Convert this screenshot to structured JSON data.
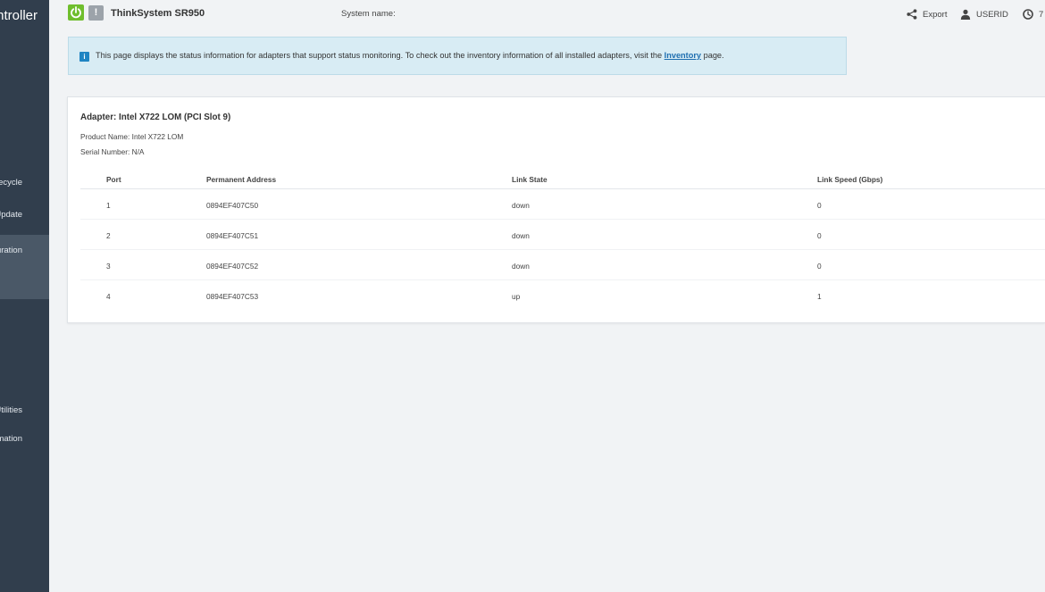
{
  "sidebar": {
    "brand": "Controller",
    "items": [
      {
        "label": "Lifecycle",
        "active": false
      },
      {
        "label": "Update",
        "active": false
      },
      {
        "label": "Configuration",
        "active": true
      },
      {
        "label": "Utilities",
        "active": false
      },
      {
        "label": "Information",
        "active": false
      }
    ]
  },
  "header": {
    "model": "ThinkSystem SR950",
    "system_name_label": "System name:",
    "export_label": "Export",
    "user_label": "USERID",
    "time_label": "7"
  },
  "banner": {
    "text_before": "This page displays the status information for adapters that support status monitoring. To check out the inventory information of all installed adapters, visit the",
    "link_text": "Inventory",
    "text_after": "page."
  },
  "adapter": {
    "title": "Adapter: Intel X722 LOM (PCI Slot 9)",
    "product_name": "Product Name: Intel X722 LOM",
    "serial_number": "Serial Number: N/A"
  },
  "table": {
    "columns": [
      "Port",
      "Permanent Address",
      "Link State",
      "Link Speed (Gbps)"
    ],
    "rows": [
      {
        "port": "1",
        "address": "0894EF407C50",
        "state": "down",
        "speed": "0"
      },
      {
        "port": "2",
        "address": "0894EF407C51",
        "state": "down",
        "speed": "0"
      },
      {
        "port": "3",
        "address": "0894EF407C52",
        "state": "down",
        "speed": "0"
      },
      {
        "port": "4",
        "address": "0894EF407C53",
        "state": "up",
        "speed": "1"
      }
    ]
  },
  "colors": {
    "sidebar_bg": "#313e4d",
    "power_green": "#6fbe2d",
    "banner_bg": "#d8ecf4",
    "link_blue": "#1f6fb0"
  }
}
